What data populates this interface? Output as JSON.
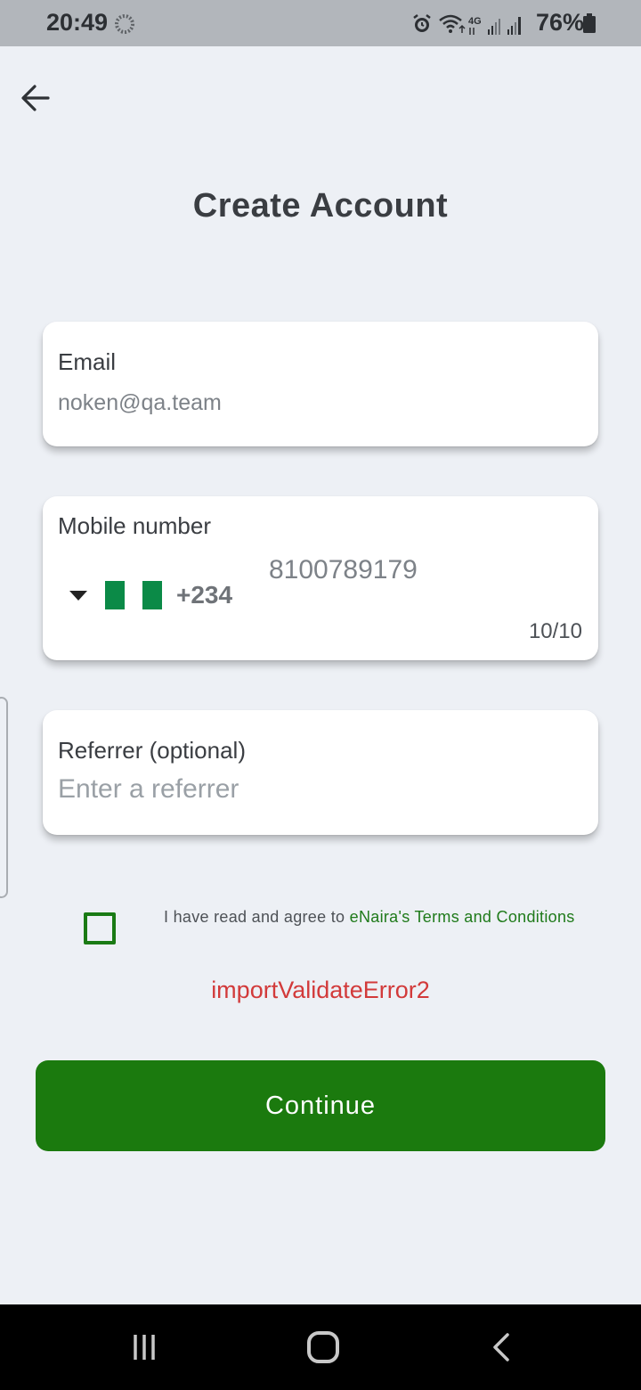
{
  "status_bar": {
    "time": "20:49",
    "battery_percent": "76%",
    "network_label": "4G"
  },
  "header": {
    "title": "Create Account"
  },
  "form": {
    "email": {
      "label": "Email",
      "value": "noken@qa.team"
    },
    "mobile": {
      "label": "Mobile number",
      "dial_code": "+234",
      "value": "8100789179",
      "counter": "10/10",
      "flag_colors": [
        "#0b8a47",
        "#ffffff",
        "#0b8a47"
      ]
    },
    "referrer": {
      "label": "Referrer (optional)",
      "placeholder": "Enter a referrer"
    }
  },
  "terms": {
    "text": "I have read and agree to ",
    "link": "eNaira's Terms and Conditions",
    "checked": false
  },
  "error": {
    "message": "importValidateError2"
  },
  "actions": {
    "continue_label": "Continue"
  },
  "colors": {
    "accent": "#1b7a0e",
    "error": "#d23a3a",
    "background": "#edf0f5"
  }
}
